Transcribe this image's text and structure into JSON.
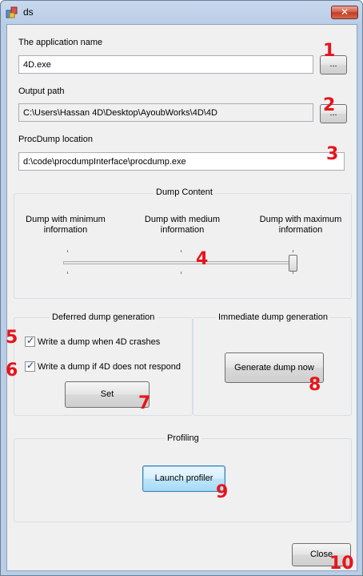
{
  "window": {
    "title": "ds"
  },
  "app_name": {
    "label": "The application name",
    "value": "4D.exe",
    "browse_label": "..."
  },
  "output_path": {
    "label": "Output path",
    "value": "C:\\Users\\Hassan 4D\\Desktop\\AyoubWorks\\4D\\4D",
    "browse_label": "..."
  },
  "procdump": {
    "label": "ProcDump location",
    "value": "d:\\code\\procdumpInterface\\procdump.exe"
  },
  "dump_content": {
    "title": "Dump Content",
    "levels": [
      {
        "line1": "Dump with minimum",
        "line2": "information"
      },
      {
        "line1": "Dump with medium",
        "line2": "information"
      },
      {
        "line1": "Dump with maximum",
        "line2": "information"
      }
    ],
    "selected_level": "maximum"
  },
  "deferred": {
    "title": "Deferred dump generation",
    "crash_label": "Write a dump when 4D crashes",
    "crash_checked": true,
    "no_respond_label": "Write a dump if 4D does not respond",
    "no_respond_checked": true,
    "set_label": "Set"
  },
  "immediate": {
    "title": "Immediate dump generation",
    "generate_label": "Generate dump now"
  },
  "profiling": {
    "title": "Profiling",
    "launch_label": "Launch profiler"
  },
  "close_label": "Close",
  "annotations": [
    "1",
    "2",
    "3",
    "4",
    "5",
    "6",
    "7",
    "8",
    "9",
    "10"
  ],
  "colors": {
    "annotation": "#e8141b",
    "titlebar": "#b9cde6",
    "dialog_bg": "#f0f0f0"
  }
}
